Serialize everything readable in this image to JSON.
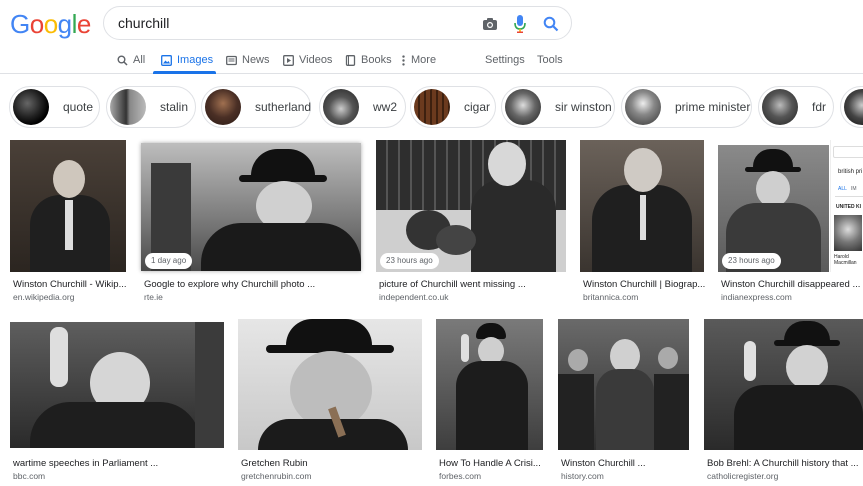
{
  "logo": {
    "letters": [
      "G",
      "o",
      "o",
      "g",
      "l",
      "e"
    ],
    "colors": [
      "#4285f4",
      "#ea4335",
      "#fbbc05",
      "#4285f4",
      "#34a853",
      "#ea4335"
    ]
  },
  "search": {
    "query": "churchill"
  },
  "tabs": [
    {
      "label": "All",
      "icon": "search-icon"
    },
    {
      "label": "Images",
      "icon": "image-icon",
      "active": true
    },
    {
      "label": "News",
      "icon": "news-icon"
    },
    {
      "label": "Videos",
      "icon": "video-icon"
    },
    {
      "label": "Books",
      "icon": "book-icon"
    },
    {
      "label": "More",
      "icon": "more-icon"
    },
    {
      "label": "Settings"
    },
    {
      "label": "Tools"
    }
  ],
  "chips": [
    "quote",
    "stalin",
    "sutherland",
    "ww2",
    "cigar",
    "sir winston",
    "prime minister",
    "fdr"
  ],
  "results_row1": [
    {
      "caption": "Winston Churchill - Wikip...",
      "source": "en.wikipedia.org"
    },
    {
      "caption": "Google to explore why Churchill photo ...",
      "source": "rte.ie",
      "badge": "1 day ago"
    },
    {
      "caption": "picture of Churchill went missing ...",
      "source": "independent.co.uk",
      "badge": "23 hours ago"
    },
    {
      "caption": "Winston Churchill | Biograp...",
      "source": "britannica.com"
    },
    {
      "caption": "Winston Churchill disappeared ...",
      "source": "indianexpress.com",
      "badge": "23 hours ago"
    }
  ],
  "side_panel": {
    "text1": "british pri",
    "tabs": [
      "ALL",
      "IM"
    ],
    "text2": "UNITED KI",
    "name": "Harold Macmillan"
  },
  "results_row2": [
    {
      "caption": "wartime speeches in Parliament ...",
      "source": "bbc.com"
    },
    {
      "caption": "Gretchen Rubin",
      "source": "gretchenrubin.com"
    },
    {
      "caption": "How To Handle A Crisi...",
      "source": "forbes.com"
    },
    {
      "caption": "Winston Churchill ...",
      "source": "history.com"
    },
    {
      "caption": "Bob Brehl: A Churchill history that ...",
      "source": "catholicregister.org"
    }
  ]
}
